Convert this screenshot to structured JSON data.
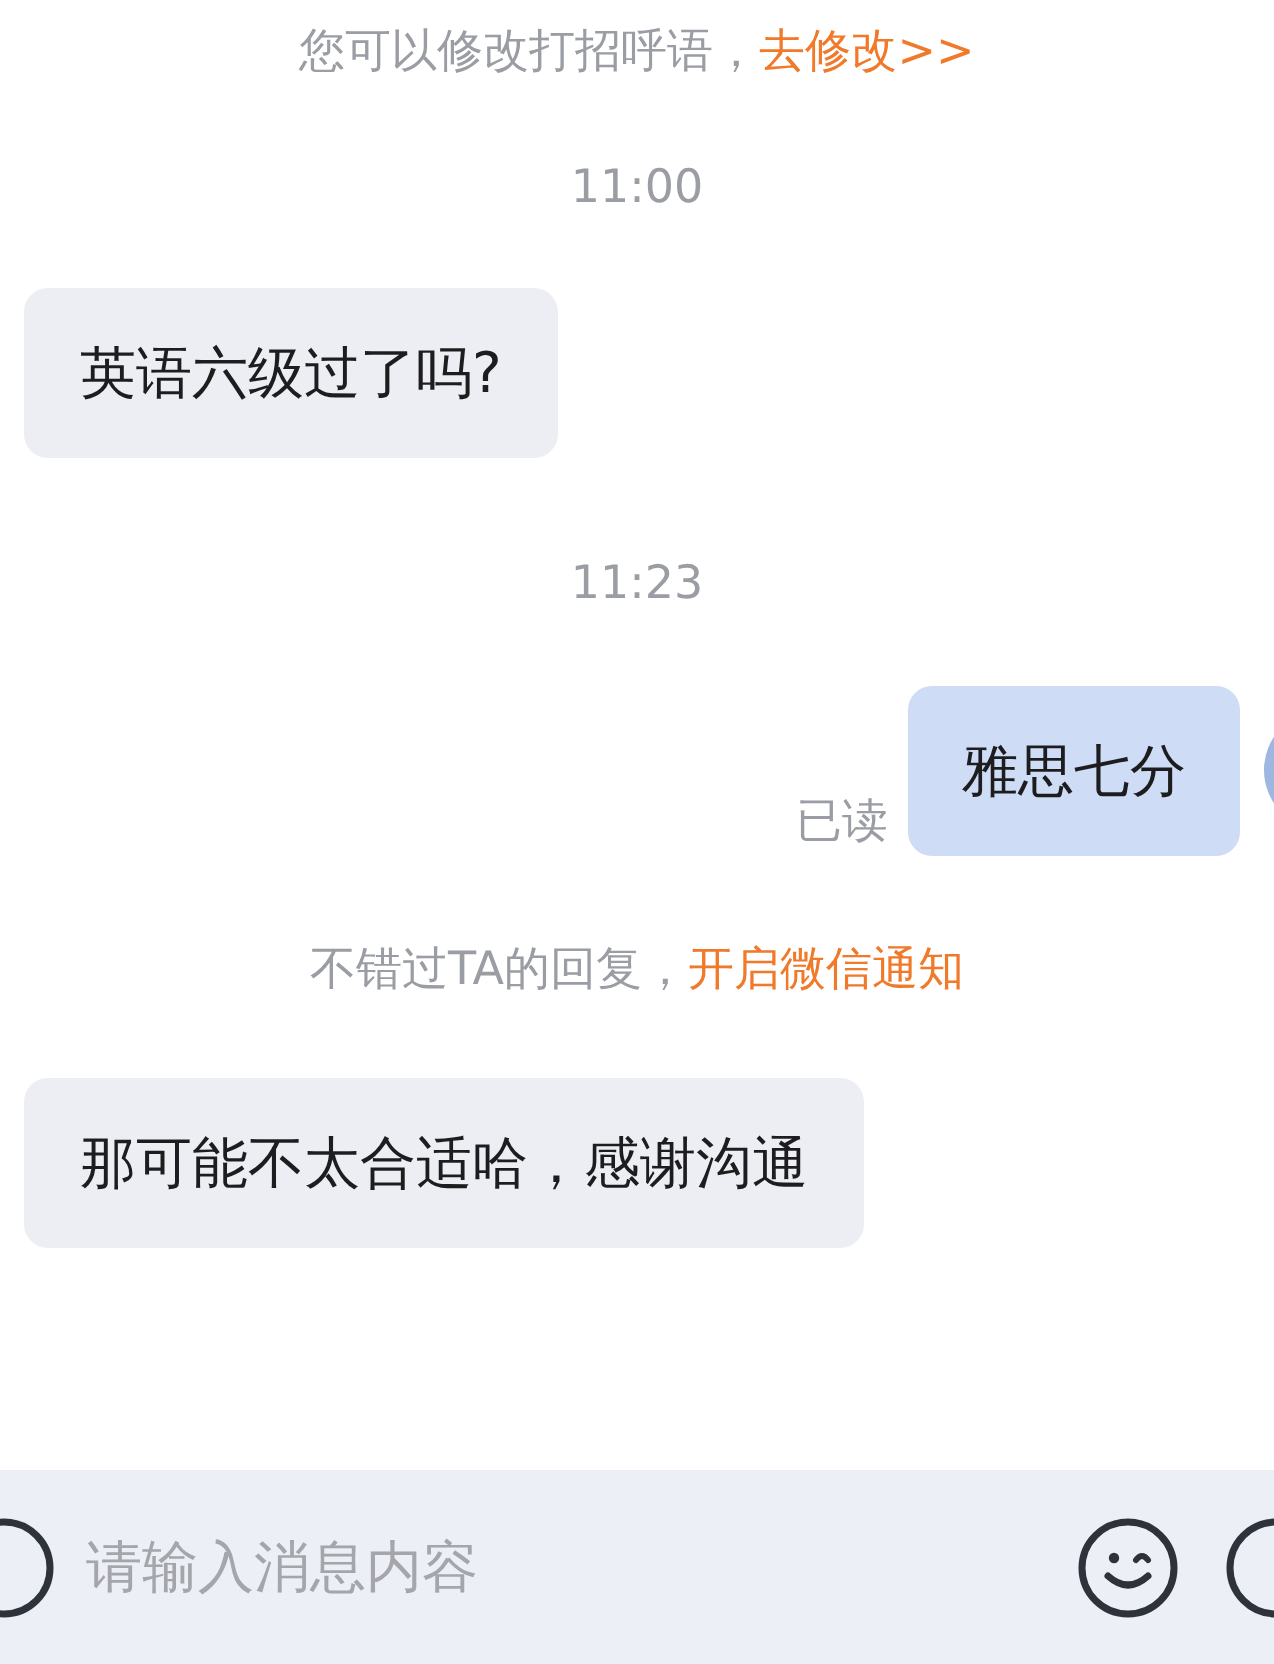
{
  "messages": [
    {
      "kind": "notice",
      "text": "您可以修改打招呼语，",
      "link": "去修改>>"
    },
    {
      "kind": "time",
      "text": "11:00"
    },
    {
      "kind": "incoming",
      "text": "英语六级过了吗?"
    },
    {
      "kind": "time",
      "text": "11:23"
    },
    {
      "kind": "outgoing",
      "text": "雅思七分",
      "status": "已读"
    },
    {
      "kind": "notice",
      "text": "不错过TA的回复，",
      "link": "开启微信通知"
    },
    {
      "kind": "incoming",
      "text": "那可能不太合适哈，感谢沟通"
    }
  ],
  "input": {
    "placeholder": "请输入消息内容"
  }
}
